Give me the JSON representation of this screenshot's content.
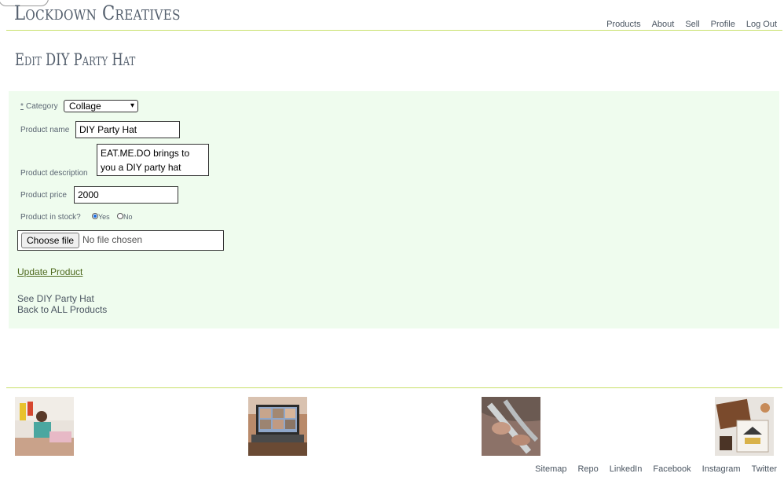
{
  "site": {
    "title": "Lockdown Creatives"
  },
  "nav": {
    "items": [
      "Products",
      "About",
      "Sell",
      "Profile",
      "Log Out"
    ]
  },
  "page": {
    "title": "Edit DIY Party Hat"
  },
  "form": {
    "category_req": "*",
    "category_label": "Category",
    "category_value": "Collage",
    "name_label": "Product name",
    "name_value": "DIY Party Hat",
    "desc_label": "Product description",
    "desc_value": "EAT.ME.DO brings to you a DIY party hat",
    "price_label": "Product price",
    "price_value": "2000",
    "stock_label": "Product in stock?",
    "stock_yes": "Yes",
    "stock_no": "No",
    "stock_selected": "Yes",
    "file_button": "Choose file",
    "file_status": "No file chosen",
    "submit": "Update Product"
  },
  "links": {
    "see_product": "See DIY Party Hat",
    "back": "Back to ALL Products"
  },
  "footer": {
    "links": [
      "Sitemap",
      "Repo",
      "LinkedIn",
      "Facebook",
      "Instagram",
      "Twitter"
    ]
  },
  "colors": {
    "accent_line": "#c8e06a",
    "panel_bg": "#effcee",
    "submit_link": "#4f6a1f"
  }
}
